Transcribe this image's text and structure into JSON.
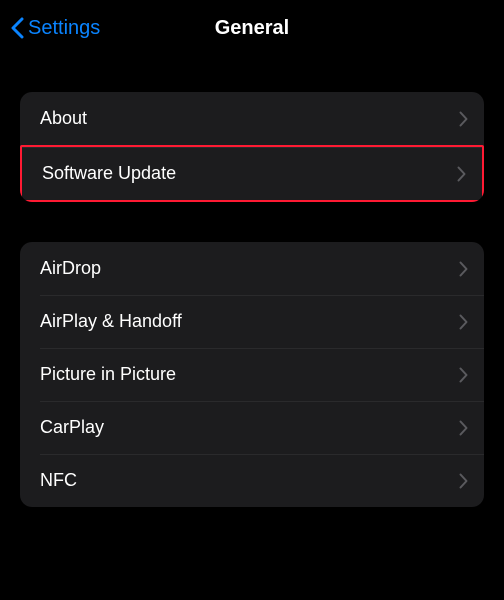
{
  "nav": {
    "back_label": "Settings",
    "title": "General"
  },
  "groups": [
    {
      "items": [
        {
          "label": "About",
          "highlighted": false
        },
        {
          "label": "Software Update",
          "highlighted": true
        }
      ]
    },
    {
      "items": [
        {
          "label": "AirDrop",
          "highlighted": false
        },
        {
          "label": "AirPlay & Handoff",
          "highlighted": false
        },
        {
          "label": "Picture in Picture",
          "highlighted": false
        },
        {
          "label": "CarPlay",
          "highlighted": false
        },
        {
          "label": "NFC",
          "highlighted": false
        }
      ]
    }
  ],
  "colors": {
    "accent": "#0a84ff",
    "group_bg": "#1c1c1e",
    "highlight_border": "#ff1a33"
  }
}
